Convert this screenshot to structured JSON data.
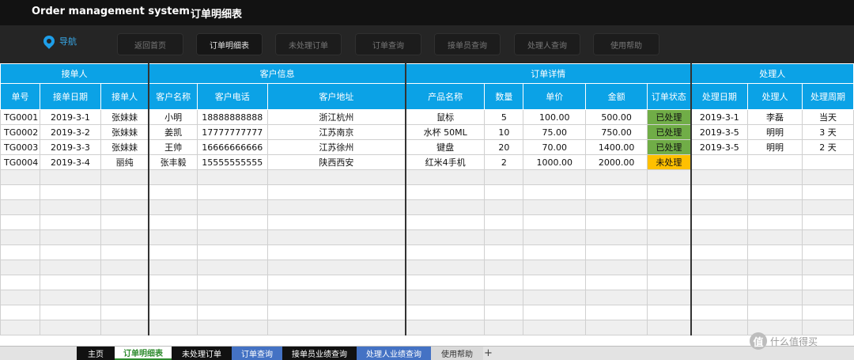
{
  "app": {
    "title": "Order management system",
    "sheet_title": "订单明细表"
  },
  "nav": {
    "label": "导航",
    "buttons": [
      "返回首页",
      "订单明细表",
      "未处理订单",
      "订单查询",
      "接单员查询",
      "处理人查询",
      "使用帮助"
    ]
  },
  "table": {
    "groups": [
      "接单人",
      "客户信息",
      "订单详情",
      "处理人"
    ],
    "headers": [
      "单号",
      "接单日期",
      "接单人",
      "客户名称",
      "客户电话",
      "客户地址",
      "产品名称",
      "数量",
      "单价",
      "金额",
      "订单状态",
      "处理日期",
      "处理人",
      "处理周期"
    ],
    "rows": [
      [
        "TG0001",
        "2019-3-1",
        "张妹妹",
        "小明",
        "18888888888",
        "浙江杭州",
        "鼠标",
        "5",
        "100.00",
        "500.00",
        "已处理",
        "2019-3-1",
        "李磊",
        "当天"
      ],
      [
        "TG0002",
        "2019-3-2",
        "张妹妹",
        "姜凯",
        "17777777777",
        "江苏南京",
        "水杯 50ML",
        "10",
        "75.00",
        "750.00",
        "已处理",
        "2019-3-5",
        "明明",
        "3 天"
      ],
      [
        "TG0003",
        "2019-3-3",
        "张妹妹",
        "王帅",
        "16666666666",
        "江苏徐州",
        "键盘",
        "20",
        "70.00",
        "1400.00",
        "已处理",
        "2019-3-5",
        "明明",
        "2 天"
      ],
      [
        "TG0004",
        "2019-3-4",
        "丽纯",
        "张丰毅",
        "15555555555",
        "陕西西安",
        "红米4手机",
        "2",
        "1000.00",
        "2000.00",
        "未处理",
        "",
        "",
        ""
      ]
    ]
  },
  "tabs": [
    "主页",
    "订单明细表",
    "未处理订单",
    "订单查询",
    "接单员业绩查询",
    "处理人业绩查询",
    "使用帮助"
  ],
  "watermark": {
    "text": "什么值得买",
    "logo_char": "值"
  },
  "colors": {
    "header_blue": "#0ba2e6",
    "done_green": "#70ad47",
    "pending_orange": "#ffc000"
  }
}
